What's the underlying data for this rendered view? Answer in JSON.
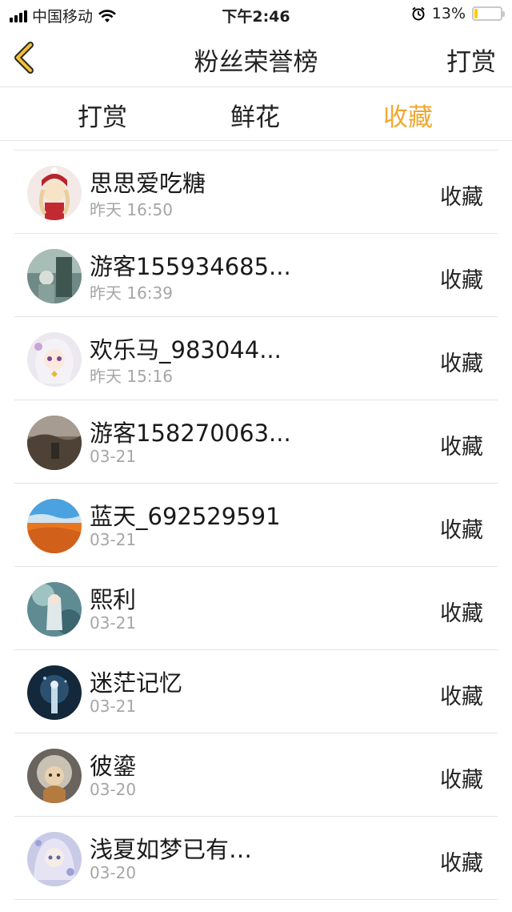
{
  "status_bar": {
    "carrier": "中国移动",
    "time": "下午2:46",
    "battery": "13%",
    "battery_level": 0.13
  },
  "nav": {
    "back_icon": "chevron-left-icon",
    "title": "粉丝荣誉榜",
    "right_label": "打赏"
  },
  "tabs": [
    {
      "label": "打赏",
      "active": false
    },
    {
      "label": "鲜花",
      "active": false
    },
    {
      "label": "收藏",
      "active": true
    }
  ],
  "colors": {
    "accent": "#f0a830",
    "battery_fill": "#ffcc00"
  },
  "list": [
    {
      "name": "思思爱吃糖",
      "time": "昨天 16:50",
      "action": "收藏"
    },
    {
      "name": "游客155934685...",
      "time": "昨天 16:39",
      "action": "收藏"
    },
    {
      "name": "欢乐马_983044...",
      "time": "昨天 15:16",
      "action": "收藏"
    },
    {
      "name": "游客158270063...",
      "time": "03-21",
      "action": "收藏"
    },
    {
      "name": "蓝天_692529591",
      "time": "03-21",
      "action": "收藏"
    },
    {
      "name": "熙利",
      "time": "03-21",
      "action": "收藏"
    },
    {
      "name": "迷茫记忆",
      "time": "03-21",
      "action": "收藏"
    },
    {
      "name": "彼鎏",
      "time": "03-20",
      "action": "收藏"
    },
    {
      "name": "浅夏如梦已有…",
      "time": "03-20",
      "action": "收藏"
    }
  ]
}
